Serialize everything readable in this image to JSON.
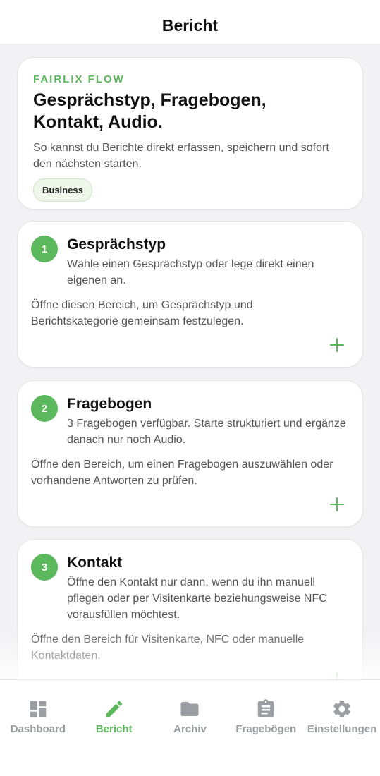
{
  "header": {
    "title": "Bericht"
  },
  "hero": {
    "brand": "FAIRLIX FLOW",
    "headline": "Gesprächstyp, Fragebogen, Kontakt, Audio.",
    "subtitle": "So kannst du Berichte direkt erfassen, speichern und sofort den nächsten starten.",
    "badge": "Business"
  },
  "steps": [
    {
      "number": "1",
      "title": "Gesprächstyp",
      "description": "Wähle einen Gesprächstyp oder lege direkt einen eigenen an.",
      "body": "Öffne diesen Bereich, um Gesprächstyp und Berichtskategorie gemeinsam festzulegen."
    },
    {
      "number": "2",
      "title": "Fragebogen",
      "description": "3 Fragebogen verfügbar. Starte strukturiert und ergänze danach nur noch Audio.",
      "body": "Öffne den Bereich, um einen Fragebogen auszuwählen oder vorhandene Antworten zu prüfen."
    },
    {
      "number": "3",
      "title": "Kontakt",
      "description": "Öffne den Kontakt nur dann, wenn du ihn manuell pflegen oder per Visitenkarte beziehungsweise NFC vorausfüllen möchtest.",
      "body": "Öffne den Bereich für Visitenkarte, NFC oder manuelle Kontaktdaten."
    }
  ],
  "tabs": [
    {
      "label": "Dashboard",
      "icon": "dashboard-icon"
    },
    {
      "label": "Bericht",
      "icon": "pencil-icon",
      "active": true
    },
    {
      "label": "Archiv",
      "icon": "folder-icon"
    },
    {
      "label": "Fragebögen",
      "icon": "clipboard-icon"
    },
    {
      "label": "Einstellungen",
      "icon": "gear-icon"
    }
  ],
  "colors": {
    "accent": "#5cb85c",
    "inactive_tab": "#9b9ea3",
    "background": "#f2f2f4"
  }
}
